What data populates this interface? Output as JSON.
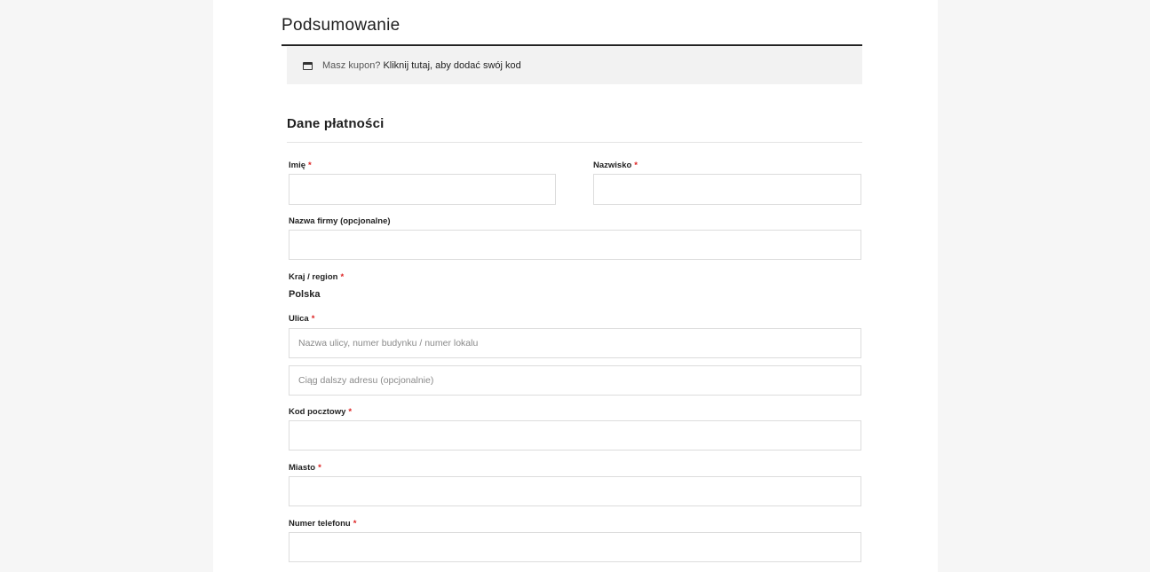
{
  "page": {
    "title": "Podsumowanie"
  },
  "coupon": {
    "icon": "coupon-icon",
    "text": "Masz kupon?",
    "link_text": "Kliknij tutaj, aby dodać swój kod"
  },
  "billing": {
    "title": "Dane płatności",
    "required_marker": "*",
    "required_color": "#dd2222",
    "first_name": {
      "label": "Imię",
      "value": ""
    },
    "last_name": {
      "label": "Nazwisko",
      "value": ""
    },
    "company": {
      "label": "Nazwa firmy (opcjonalne)",
      "value": ""
    },
    "country": {
      "label": "Kraj / region",
      "value": "Polska"
    },
    "street": {
      "label": "Ulica",
      "placeholder_line1": "Nazwa ulicy, numer budynku / numer lokalu",
      "placeholder_line2": "Ciąg dalszy adresu (opcjonalnie)"
    },
    "postcode": {
      "label": "Kod pocztowy",
      "value": ""
    },
    "city": {
      "label": "Miasto",
      "value": ""
    },
    "phone": {
      "label": "Numer telefonu",
      "value": ""
    }
  }
}
